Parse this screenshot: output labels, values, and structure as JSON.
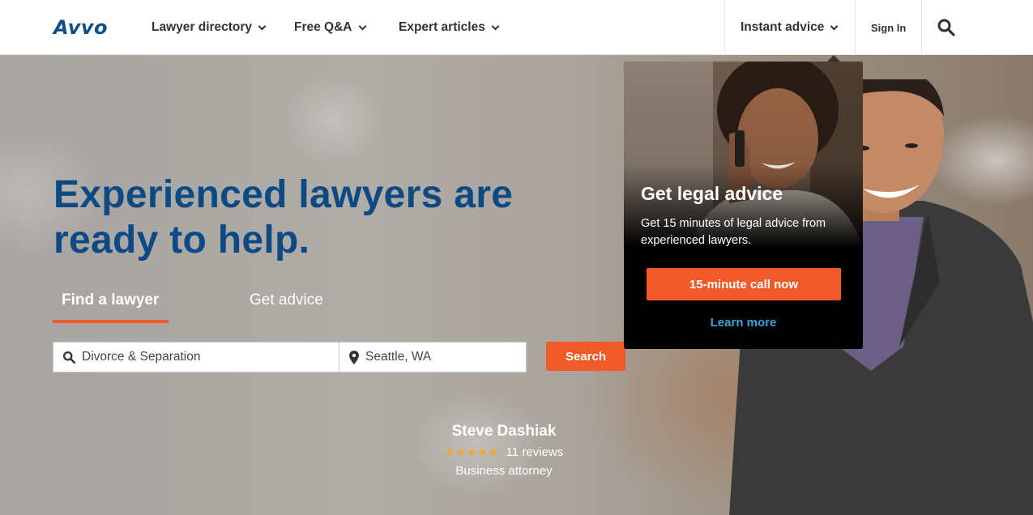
{
  "header": {
    "logo": "Avvo",
    "nav": [
      {
        "label": "Lawyer directory"
      },
      {
        "label": "Free Q&A"
      },
      {
        "label": "Expert articles"
      },
      {
        "label": "Instant advice"
      }
    ],
    "sign_in": "Sign In",
    "search_icon": "search-icon"
  },
  "hero": {
    "headline_line1": "Experienced lawyers are",
    "headline_line2": "ready to help.",
    "tabs": [
      {
        "label": "Find a lawyer",
        "active": true
      },
      {
        "label": "Get advice",
        "active": false
      }
    ],
    "search": {
      "topic_value": "Divorce & Separation",
      "location_value": "Seattle, WA",
      "button_label": "Search"
    },
    "featured_attorney": {
      "name": "Steve Dashiak",
      "rating_stars": 5,
      "reviews": "11 reviews",
      "title": "Business attorney"
    }
  },
  "popup": {
    "title": "Get legal advice",
    "description": "Get 15 minutes of legal advice from experienced lawyers.",
    "cta_label": "15-minute call now",
    "learn_more": "Learn more"
  },
  "colors": {
    "brand_blue": "#0d4a85",
    "accent_orange": "#f25a29",
    "link_blue": "#3ba3dc",
    "star_gold": "#f5a623"
  }
}
